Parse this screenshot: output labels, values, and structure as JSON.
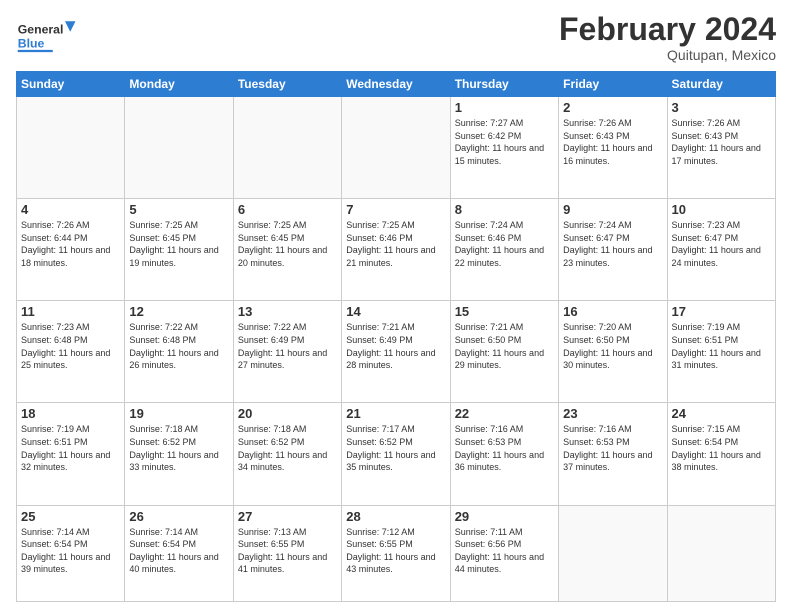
{
  "header": {
    "logo_general": "General",
    "logo_blue": "Blue",
    "month_year": "February 2024",
    "location": "Quitupan, Mexico"
  },
  "days_of_week": [
    "Sunday",
    "Monday",
    "Tuesday",
    "Wednesday",
    "Thursday",
    "Friday",
    "Saturday"
  ],
  "weeks": [
    [
      {
        "day": "",
        "sunrise": "",
        "sunset": "",
        "daylight": ""
      },
      {
        "day": "",
        "sunrise": "",
        "sunset": "",
        "daylight": ""
      },
      {
        "day": "",
        "sunrise": "",
        "sunset": "",
        "daylight": ""
      },
      {
        "day": "",
        "sunrise": "",
        "sunset": "",
        "daylight": ""
      },
      {
        "day": "1",
        "sunrise": "Sunrise: 7:27 AM",
        "sunset": "Sunset: 6:42 PM",
        "daylight": "Daylight: 11 hours and 15 minutes."
      },
      {
        "day": "2",
        "sunrise": "Sunrise: 7:26 AM",
        "sunset": "Sunset: 6:43 PM",
        "daylight": "Daylight: 11 hours and 16 minutes."
      },
      {
        "day": "3",
        "sunrise": "Sunrise: 7:26 AM",
        "sunset": "Sunset: 6:43 PM",
        "daylight": "Daylight: 11 hours and 17 minutes."
      }
    ],
    [
      {
        "day": "4",
        "sunrise": "Sunrise: 7:26 AM",
        "sunset": "Sunset: 6:44 PM",
        "daylight": "Daylight: 11 hours and 18 minutes."
      },
      {
        "day": "5",
        "sunrise": "Sunrise: 7:25 AM",
        "sunset": "Sunset: 6:45 PM",
        "daylight": "Daylight: 11 hours and 19 minutes."
      },
      {
        "day": "6",
        "sunrise": "Sunrise: 7:25 AM",
        "sunset": "Sunset: 6:45 PM",
        "daylight": "Daylight: 11 hours and 20 minutes."
      },
      {
        "day": "7",
        "sunrise": "Sunrise: 7:25 AM",
        "sunset": "Sunset: 6:46 PM",
        "daylight": "Daylight: 11 hours and 21 minutes."
      },
      {
        "day": "8",
        "sunrise": "Sunrise: 7:24 AM",
        "sunset": "Sunset: 6:46 PM",
        "daylight": "Daylight: 11 hours and 22 minutes."
      },
      {
        "day": "9",
        "sunrise": "Sunrise: 7:24 AM",
        "sunset": "Sunset: 6:47 PM",
        "daylight": "Daylight: 11 hours and 23 minutes."
      },
      {
        "day": "10",
        "sunrise": "Sunrise: 7:23 AM",
        "sunset": "Sunset: 6:47 PM",
        "daylight": "Daylight: 11 hours and 24 minutes."
      }
    ],
    [
      {
        "day": "11",
        "sunrise": "Sunrise: 7:23 AM",
        "sunset": "Sunset: 6:48 PM",
        "daylight": "Daylight: 11 hours and 25 minutes."
      },
      {
        "day": "12",
        "sunrise": "Sunrise: 7:22 AM",
        "sunset": "Sunset: 6:48 PM",
        "daylight": "Daylight: 11 hours and 26 minutes."
      },
      {
        "day": "13",
        "sunrise": "Sunrise: 7:22 AM",
        "sunset": "Sunset: 6:49 PM",
        "daylight": "Daylight: 11 hours and 27 minutes."
      },
      {
        "day": "14",
        "sunrise": "Sunrise: 7:21 AM",
        "sunset": "Sunset: 6:49 PM",
        "daylight": "Daylight: 11 hours and 28 minutes."
      },
      {
        "day": "15",
        "sunrise": "Sunrise: 7:21 AM",
        "sunset": "Sunset: 6:50 PM",
        "daylight": "Daylight: 11 hours and 29 minutes."
      },
      {
        "day": "16",
        "sunrise": "Sunrise: 7:20 AM",
        "sunset": "Sunset: 6:50 PM",
        "daylight": "Daylight: 11 hours and 30 minutes."
      },
      {
        "day": "17",
        "sunrise": "Sunrise: 7:19 AM",
        "sunset": "Sunset: 6:51 PM",
        "daylight": "Daylight: 11 hours and 31 minutes."
      }
    ],
    [
      {
        "day": "18",
        "sunrise": "Sunrise: 7:19 AM",
        "sunset": "Sunset: 6:51 PM",
        "daylight": "Daylight: 11 hours and 32 minutes."
      },
      {
        "day": "19",
        "sunrise": "Sunrise: 7:18 AM",
        "sunset": "Sunset: 6:52 PM",
        "daylight": "Daylight: 11 hours and 33 minutes."
      },
      {
        "day": "20",
        "sunrise": "Sunrise: 7:18 AM",
        "sunset": "Sunset: 6:52 PM",
        "daylight": "Daylight: 11 hours and 34 minutes."
      },
      {
        "day": "21",
        "sunrise": "Sunrise: 7:17 AM",
        "sunset": "Sunset: 6:52 PM",
        "daylight": "Daylight: 11 hours and 35 minutes."
      },
      {
        "day": "22",
        "sunrise": "Sunrise: 7:16 AM",
        "sunset": "Sunset: 6:53 PM",
        "daylight": "Daylight: 11 hours and 36 minutes."
      },
      {
        "day": "23",
        "sunrise": "Sunrise: 7:16 AM",
        "sunset": "Sunset: 6:53 PM",
        "daylight": "Daylight: 11 hours and 37 minutes."
      },
      {
        "day": "24",
        "sunrise": "Sunrise: 7:15 AM",
        "sunset": "Sunset: 6:54 PM",
        "daylight": "Daylight: 11 hours and 38 minutes."
      }
    ],
    [
      {
        "day": "25",
        "sunrise": "Sunrise: 7:14 AM",
        "sunset": "Sunset: 6:54 PM",
        "daylight": "Daylight: 11 hours and 39 minutes."
      },
      {
        "day": "26",
        "sunrise": "Sunrise: 7:14 AM",
        "sunset": "Sunset: 6:54 PM",
        "daylight": "Daylight: 11 hours and 40 minutes."
      },
      {
        "day": "27",
        "sunrise": "Sunrise: 7:13 AM",
        "sunset": "Sunset: 6:55 PM",
        "daylight": "Daylight: 11 hours and 41 minutes."
      },
      {
        "day": "28",
        "sunrise": "Sunrise: 7:12 AM",
        "sunset": "Sunset: 6:55 PM",
        "daylight": "Daylight: 11 hours and 43 minutes."
      },
      {
        "day": "29",
        "sunrise": "Sunrise: 7:11 AM",
        "sunset": "Sunset: 6:56 PM",
        "daylight": "Daylight: 11 hours and 44 minutes."
      },
      {
        "day": "",
        "sunrise": "",
        "sunset": "",
        "daylight": ""
      },
      {
        "day": "",
        "sunrise": "",
        "sunset": "",
        "daylight": ""
      }
    ]
  ]
}
